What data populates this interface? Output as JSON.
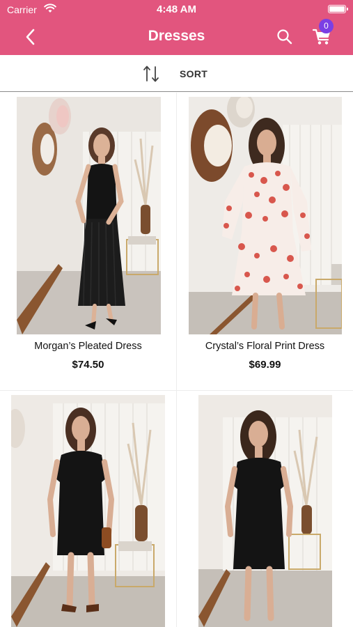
{
  "status_bar": {
    "carrier": "Carrier",
    "time": "4:48 AM"
  },
  "header": {
    "title": "Dresses",
    "cart_count": "0"
  },
  "toolbar": {
    "sort_label": "SORT"
  },
  "products": [
    {
      "name": "Morgan’s Pleated Dress",
      "price": "$74.50"
    },
    {
      "name": "Crystal’s Floral Print Dress",
      "price": "$69.99"
    },
    {
      "name": "",
      "price": ""
    },
    {
      "name": "",
      "price": ""
    }
  ],
  "colors": {
    "header": "#e2557e",
    "badge": "#7b3fe4"
  },
  "icons": [
    "wifi-icon",
    "battery-icon",
    "back-chevron-icon",
    "search-icon",
    "cart-icon",
    "sort-arrows-icon"
  ]
}
